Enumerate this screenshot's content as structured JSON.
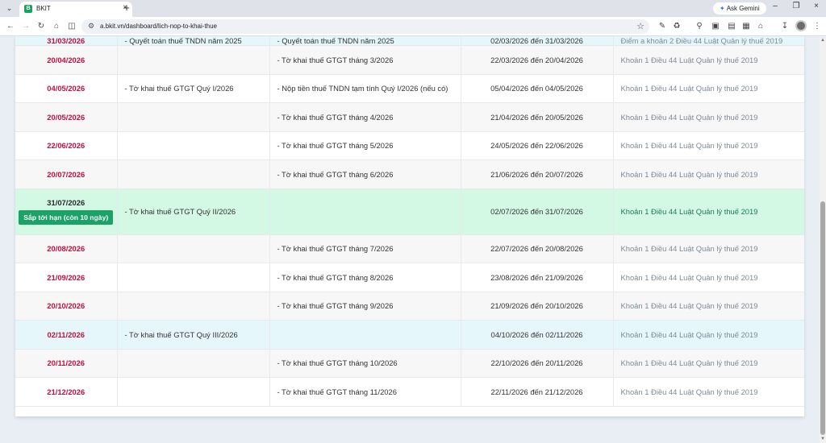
{
  "browser": {
    "tab_title": "BKIT",
    "favicon_letter": "B",
    "url": "a.bkit.vn/dashboard/lich-nop-to-khai-thue",
    "ask_gemini": "Ask Gemini"
  },
  "table": {
    "rows": [
      {
        "date": "31/03/2026",
        "quarterly": "- Quyết toán thuế TNDN năm 2025",
        "monthly": "- Quyết toán thuế TNDN năm 2025",
        "period": "02/03/2026 đến 31/03/2026",
        "basis": "Điểm a khoản 2 Điều 44 Luật Quản lý thuế 2019",
        "style": "blue"
      },
      {
        "date": "20/04/2026",
        "quarterly": "",
        "monthly": "- Tờ khai thuế GTGT tháng 3/2026",
        "period": "22/03/2026 đến 20/04/2026",
        "basis": "Khoản 1 Điều 44 Luật Quản lý thuế 2019",
        "style": "alt"
      },
      {
        "date": "04/05/2026",
        "quarterly": "- Tờ khai thuế GTGT Quý I/2026",
        "monthly": "- Nộp tiền thuế TNDN tạm tính Quý I/2026 (nếu có)",
        "period": "05/04/2026 đến 04/05/2026",
        "basis": "Khoản 1 Điều 44 Luật Quản lý thuế 2019",
        "style": "white"
      },
      {
        "date": "20/05/2026",
        "quarterly": "",
        "monthly": "- Tờ khai thuế GTGT tháng 4/2026",
        "period": "21/04/2026 đến 20/05/2026",
        "basis": "Khoản 1 Điều 44 Luật Quản lý thuế 2019",
        "style": "alt"
      },
      {
        "date": "22/06/2026",
        "quarterly": "",
        "monthly": "- Tờ khai thuế GTGT tháng 5/2026",
        "period": "24/05/2026 đến 22/06/2026",
        "basis": "Khoản 1 Điều 44 Luật Quản lý thuế 2019",
        "style": "white"
      },
      {
        "date": "20/07/2026",
        "quarterly": "",
        "monthly": "- Tờ khai thuế GTGT tháng 6/2026",
        "period": "21/06/2026 đến 20/07/2026",
        "basis": "Khoản 1 Điều 44 Luật Quản lý thuế 2019",
        "style": "alt"
      },
      {
        "date": "31/07/2026",
        "badge": "Sắp tới hạn (còn 10 ngày)",
        "quarterly": "- Tờ khai thuế GTGT Quý II/2026",
        "monthly": "",
        "period": "02/07/2026 đến 31/07/2026",
        "basis": "Khoản 1 Điều 44 Luật Quản lý thuế 2019",
        "style": "green"
      },
      {
        "date": "20/08/2026",
        "quarterly": "",
        "monthly": "- Tờ khai thuế GTGT tháng 7/2026",
        "period": "22/07/2026 đến 20/08/2026",
        "basis": "Khoản 1 Điều 44 Luật Quản lý thuế 2019",
        "style": "alt"
      },
      {
        "date": "21/09/2026",
        "quarterly": "",
        "monthly": "- Tờ khai thuế GTGT tháng 8/2026",
        "period": "23/08/2026 đến 21/09/2026",
        "basis": "Khoản 1 Điều 44 Luật Quản lý thuế 2019",
        "style": "white"
      },
      {
        "date": "20/10/2026",
        "quarterly": "",
        "monthly": "- Tờ khai thuế GTGT tháng 9/2026",
        "period": "21/09/2026 đến 20/10/2026",
        "basis": "Khoản 1 Điều 44 Luật Quản lý thuế 2019",
        "style": "alt"
      },
      {
        "date": "02/11/2026",
        "quarterly": "- Tờ khai thuế GTGT Quý III/2026",
        "monthly": "",
        "period": "04/10/2026 đến 02/11/2026",
        "basis": "Khoản 1 Điều 44 Luật Quản lý thuế 2019",
        "style": "blue"
      },
      {
        "date": "20/11/2026",
        "quarterly": "",
        "monthly": "- Tờ khai thuế GTGT tháng 10/2026",
        "period": "22/10/2026 đến 20/11/2026",
        "basis": "Khoản 1 Điều 44 Luật Quản lý thuế 2019",
        "style": "alt"
      },
      {
        "date": "21/12/2026",
        "quarterly": "",
        "monthly": "- Tờ khai thuế GTGT tháng 11/2026",
        "period": "22/11/2026 đến 21/12/2026",
        "basis": "Khoản 1 Điều 44 Luật Quản lý thuế 2019",
        "style": "white"
      }
    ]
  }
}
